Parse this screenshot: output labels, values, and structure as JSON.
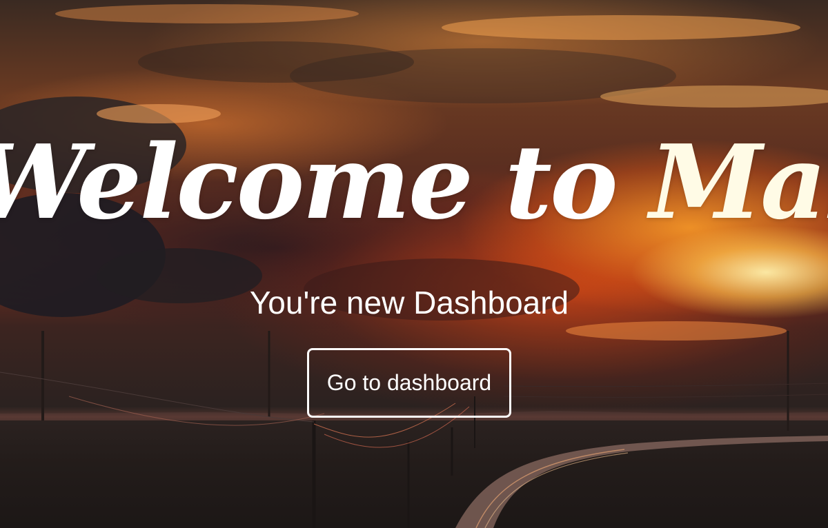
{
  "hero": {
    "headline_main": "Welcome to ",
    "headline_accent": "Maby",
    "subtitle": "You're new Dashboard",
    "cta_label": "Go to dashboard"
  },
  "colors": {
    "text": "#ffffff",
    "accent_text": "#fffbe6",
    "sky_orange": "#e8823a",
    "sky_red": "#c23a1e",
    "ground_dark": "#231c1a"
  }
}
